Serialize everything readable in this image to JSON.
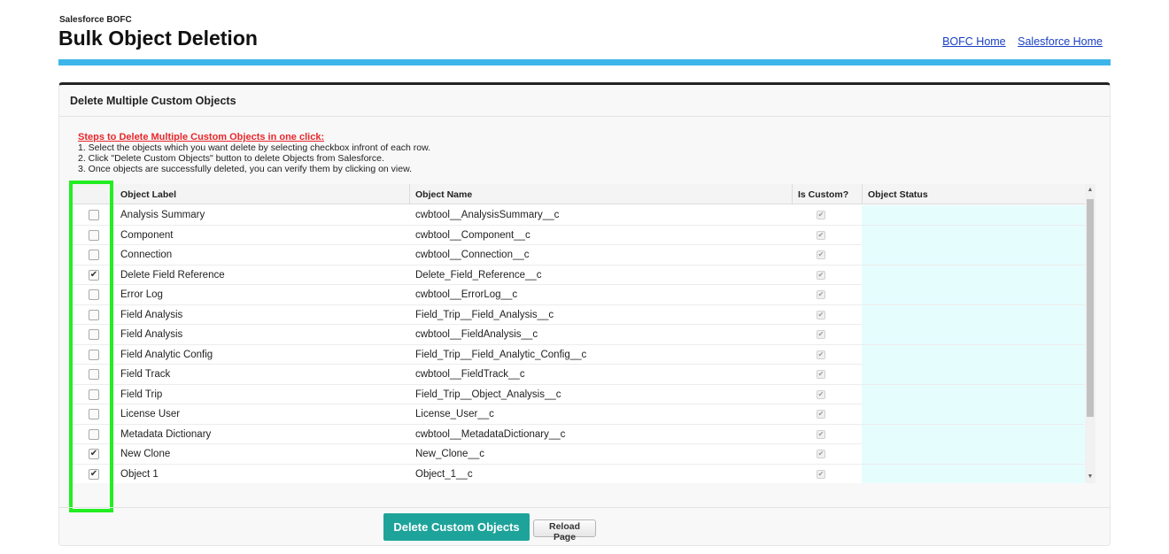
{
  "header": {
    "subtitle": "Salesforce BOFC",
    "title": "Bulk Object Deletion",
    "links": [
      "BOFC Home",
      "Salesforce Home"
    ]
  },
  "panel": {
    "title": "Delete Multiple Custom Objects",
    "steps_title": "Steps to Delete Multiple Custom Objects in one click:",
    "steps": [
      "1. Select the objects which you want delete by selecting checkbox infront of each row.",
      "2. Click \"Delete Custom Objects\" button to delete Objects from Salesforce.",
      "3. Once objects are successfully deleted, you can verify them by clicking on view."
    ]
  },
  "table": {
    "columns": [
      "Object Label",
      "Object Name",
      "Is Custom?",
      "Object Status"
    ],
    "rows": [
      {
        "label": "Analysis Summary",
        "name": "cwbtool__AnalysisSummary__c",
        "selected": false,
        "is_custom": true,
        "status": ""
      },
      {
        "label": "Component",
        "name": "cwbtool__Component__c",
        "selected": false,
        "is_custom": true,
        "status": ""
      },
      {
        "label": "Connection",
        "name": "cwbtool__Connection__c",
        "selected": false,
        "is_custom": true,
        "status": ""
      },
      {
        "label": "Delete Field Reference",
        "name": "Delete_Field_Reference__c",
        "selected": true,
        "is_custom": true,
        "status": ""
      },
      {
        "label": "Error Log",
        "name": "cwbtool__ErrorLog__c",
        "selected": false,
        "is_custom": true,
        "status": ""
      },
      {
        "label": "Field Analysis",
        "name": "Field_Trip__Field_Analysis__c",
        "selected": false,
        "is_custom": true,
        "status": ""
      },
      {
        "label": "Field Analysis",
        "name": "cwbtool__FieldAnalysis__c",
        "selected": false,
        "is_custom": true,
        "status": ""
      },
      {
        "label": "Field Analytic Config",
        "name": "Field_Trip__Field_Analytic_Config__c",
        "selected": false,
        "is_custom": true,
        "status": ""
      },
      {
        "label": "Field Track",
        "name": "cwbtool__FieldTrack__c",
        "selected": false,
        "is_custom": true,
        "status": ""
      },
      {
        "label": "Field Trip",
        "name": "Field_Trip__Object_Analysis__c",
        "selected": false,
        "is_custom": true,
        "status": ""
      },
      {
        "label": "License User",
        "name": "License_User__c",
        "selected": false,
        "is_custom": true,
        "status": ""
      },
      {
        "label": "Metadata Dictionary",
        "name": "cwbtool__MetadataDictionary__c",
        "selected": false,
        "is_custom": true,
        "status": ""
      },
      {
        "label": "New Clone",
        "name": "New_Clone__c",
        "selected": true,
        "is_custom": true,
        "status": ""
      },
      {
        "label": "Object 1",
        "name": "Object_1__c",
        "selected": true,
        "is_custom": true,
        "status": ""
      }
    ]
  },
  "buttons": {
    "delete": "Delete Custom Objects",
    "reload": "Reload Page"
  },
  "colors": {
    "accent_bar": "#3cb6ea",
    "primary_button": "#1ea39a",
    "status_cell": "#e6fdfe",
    "highlight_box": "#22ee22",
    "steps_title": "#e8272b"
  }
}
